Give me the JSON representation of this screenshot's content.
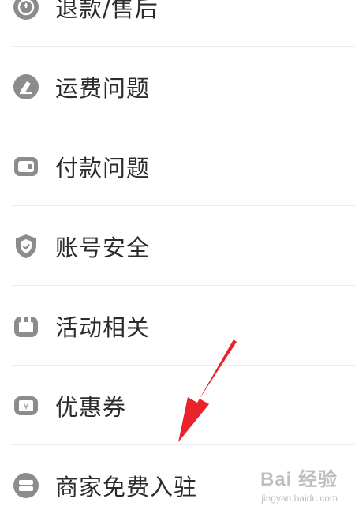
{
  "menu": {
    "items": [
      {
        "label": "退款/售后",
        "icon": "refund-icon"
      },
      {
        "label": "运费问题",
        "icon": "shipping-icon"
      },
      {
        "label": "付款问题",
        "icon": "wallet-icon"
      },
      {
        "label": "账号安全",
        "icon": "shield-icon"
      },
      {
        "label": "活动相关",
        "icon": "gift-icon"
      },
      {
        "label": "优惠券",
        "icon": "coupon-icon"
      },
      {
        "label": "商家免费入驻",
        "icon": "store-icon"
      }
    ]
  },
  "annotation": {
    "arrow_color": "#e8232b"
  },
  "watermark": {
    "brand": "Bai 经验",
    "url": "jingyan.baidu.com"
  },
  "colors": {
    "icon_gray": "#8c8c8c",
    "text": "#2b2b2b",
    "divider": "#ececec"
  }
}
